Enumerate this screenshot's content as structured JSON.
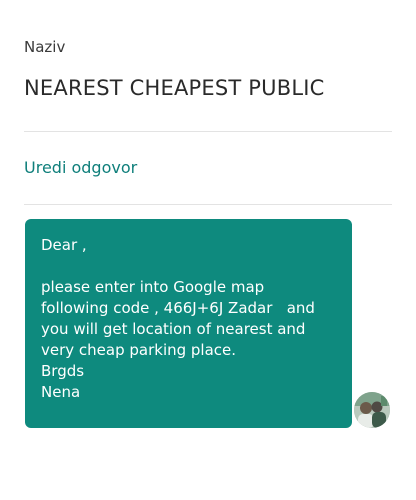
{
  "field": {
    "label": "Naziv",
    "title": "NEAREST CHEAPEST PUBLIC"
  },
  "actions": {
    "edit_label": "Uredi odgovor"
  },
  "message": {
    "lines": [
      "Dear ,",
      "",
      "please enter into Google map",
      "following code , 466J+6J Zadar   and",
      "you will get location of nearest and",
      "very cheap parking place.",
      "Brgds",
      "Nena"
    ]
  },
  "colors": {
    "accent": "#0f7f7b",
    "bubble": "#0e8a7e"
  }
}
